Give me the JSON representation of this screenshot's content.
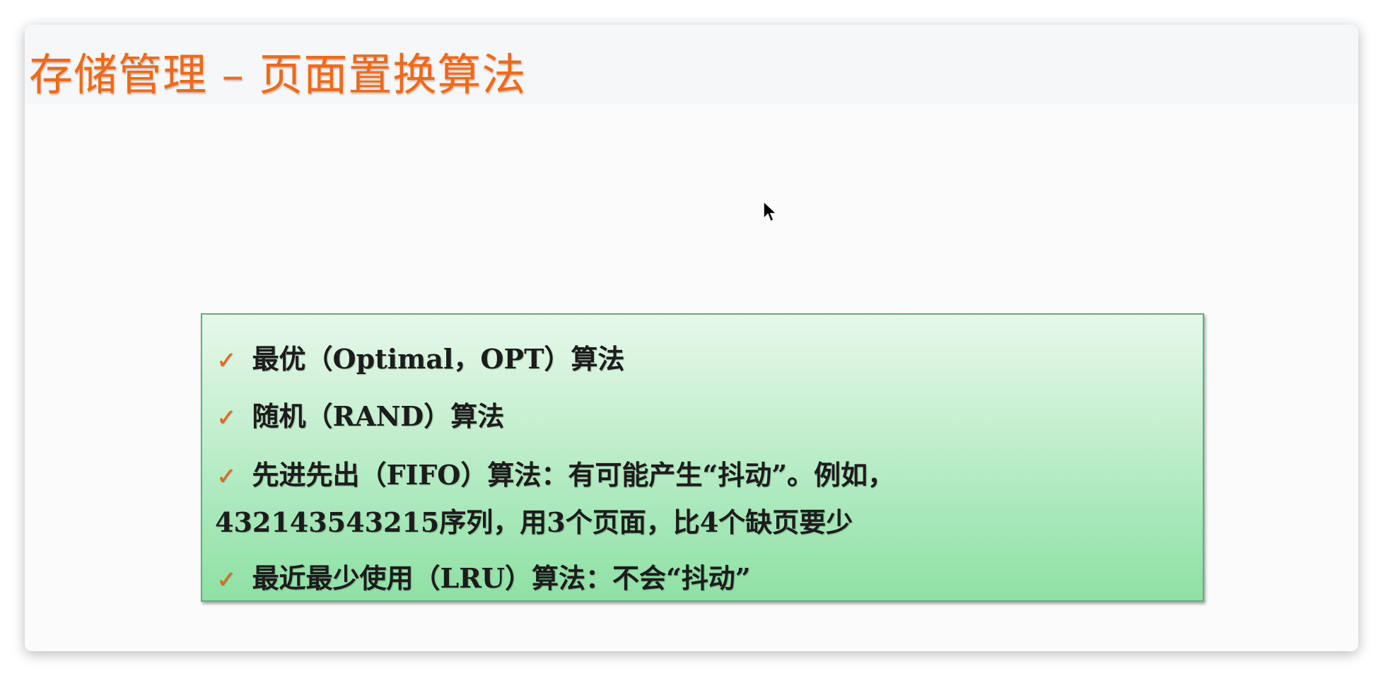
{
  "slide": {
    "title": "存储管理 – 页面置换算法",
    "items": [
      {
        "icon": "check-icon",
        "text": "最优（Optimal，OPT）算法"
      },
      {
        "icon": "check-icon",
        "text": "随机（RAND）算法"
      },
      {
        "icon": "check-icon",
        "text": "先进先出（FIFO）算法：有可能产生“抖动”。例如，"
      },
      {
        "icon": "",
        "text": "432143543215序列，用3个页面，比4个缺页要少"
      },
      {
        "icon": "check-icon",
        "text": "最近最少使用（LRU）算法：不会“抖动”"
      }
    ],
    "check_mark": "✓"
  },
  "colors": {
    "title": "#ee6a1a",
    "check": "#e8641a",
    "box_border": "#6aa884"
  }
}
